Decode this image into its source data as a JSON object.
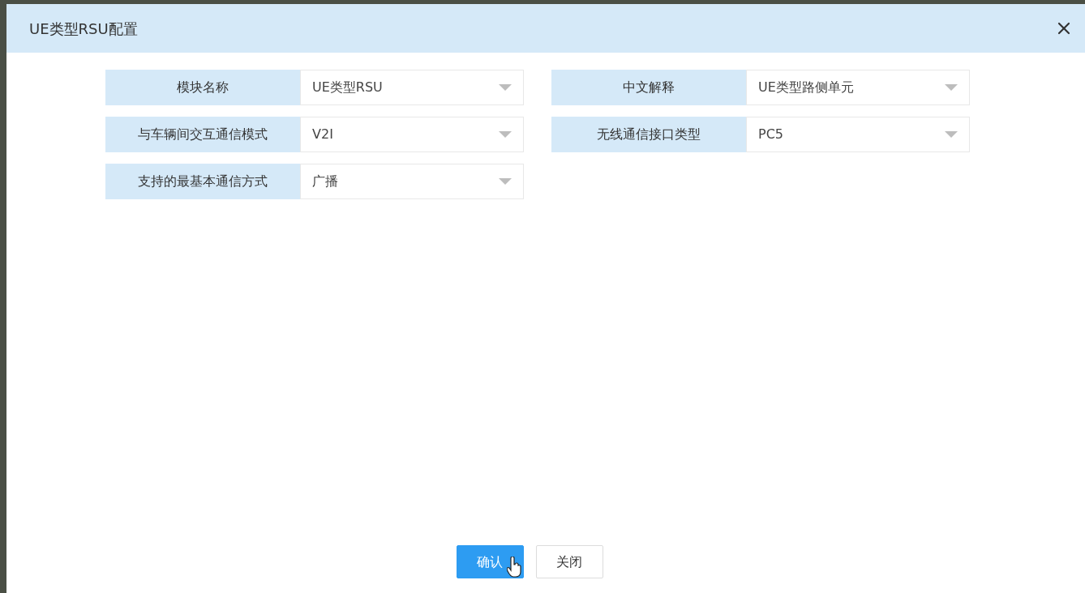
{
  "dialog": {
    "title": "UE类型RSU配置"
  },
  "fields": [
    {
      "label": "模块名称",
      "value": "UE类型RSU"
    },
    {
      "label": "中文解释",
      "value": "UE类型路侧单元"
    },
    {
      "label": "与车辆间交互通信模式",
      "value": "V2I"
    },
    {
      "label": "无线通信接口类型",
      "value": "PC5"
    },
    {
      "label": "支持的最基本通信方式",
      "value": "广播"
    }
  ],
  "buttons": [
    {
      "label": "确认",
      "kind": "primary"
    },
    {
      "label": "关闭",
      "kind": "secondary"
    }
  ]
}
